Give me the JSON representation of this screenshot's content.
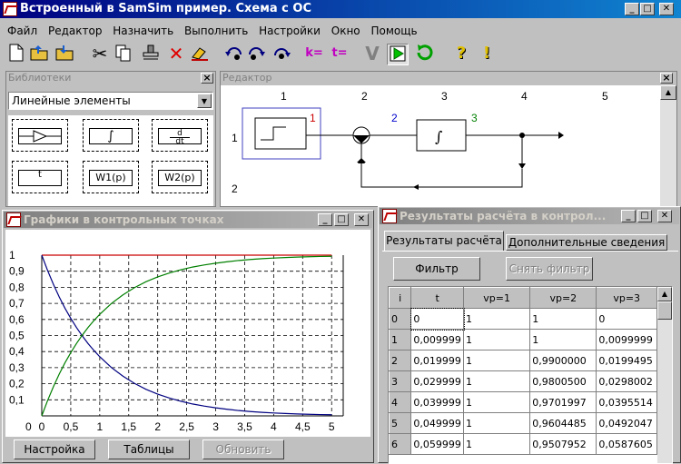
{
  "app": {
    "title": "Встроенный в SamSim пример. Схема с ОС"
  },
  "window_buttons": {
    "minimize": "_",
    "maximize": "□",
    "close": "✕"
  },
  "menu": [
    "Файл",
    "Редактор",
    "Назначить",
    "Выполнить",
    "Настройки",
    "Окно",
    "Помощь"
  ],
  "toolbar": {
    "icons": [
      "new-file-icon",
      "open-folder-icon",
      "save-folder-icon",
      "cut-icon",
      "copy-icon",
      "paste-stamp-icon",
      "delete-icon",
      "eraser-icon",
      "rotate-left-icon",
      "rotate-right-icon",
      "k-block-icon",
      "t-block-icon",
      "check-icon",
      "run-icon",
      "refresh-icon",
      "help-icon",
      "info-icon"
    ],
    "k_label": "k=",
    "t_label": "t=",
    "help_label": "?",
    "info_label": "!"
  },
  "library": {
    "title": "Библиотеки",
    "close": "×",
    "select_value": "Линейные элементы",
    "blocks": [
      "",
      "∫",
      "d/dt",
      "t",
      "W1(p)",
      "W2(p)"
    ],
    "d_num": "d",
    "d_den": "dt"
  },
  "editor": {
    "title": "Редактор",
    "close": "×",
    "col_labels": [
      "1",
      "2",
      "3",
      "4",
      "5"
    ],
    "row_labels": [
      "1",
      "2"
    ],
    "port_labels": [
      {
        "text": "1",
        "color": "#cc0000"
      },
      {
        "text": "2",
        "color": "#0000cc"
      },
      {
        "text": "3",
        "color": "#008000"
      }
    ]
  },
  "graphs": {
    "title": "Графики в контрольных точках",
    "buttons": {
      "settings": "Настройка",
      "tables": "Таблицы",
      "refresh": "Обновить"
    },
    "chart_data": {
      "type": "line",
      "x": [
        0,
        0.1,
        0.2,
        0.3,
        0.4,
        0.5,
        0.6,
        0.7,
        0.8,
        0.9,
        1.0,
        1.2,
        1.4,
        1.6,
        1.8,
        2.0,
        2.2,
        2.4,
        2.6,
        2.8,
        3.0,
        3.2,
        3.4,
        3.6,
        3.8,
        4.0,
        4.2,
        4.4,
        4.6,
        4.8,
        5.0
      ],
      "series": [
        {
          "color": "#cc0000",
          "values": [
            1,
            1,
            1,
            1,
            1,
            1,
            1,
            1,
            1,
            1,
            1,
            1,
            1,
            1,
            1,
            1,
            1,
            1,
            1,
            1,
            1,
            1,
            1,
            1,
            1,
            1,
            1,
            1,
            1,
            1,
            1
          ]
        },
        {
          "color": "#000080",
          "values": [
            1,
            0.905,
            0.819,
            0.741,
            0.67,
            0.607,
            0.549,
            0.497,
            0.449,
            0.407,
            0.368,
            0.301,
            0.247,
            0.202,
            0.165,
            0.135,
            0.111,
            0.091,
            0.074,
            0.061,
            0.05,
            0.041,
            0.033,
            0.027,
            0.022,
            0.018,
            0.015,
            0.012,
            0.01,
            0.008,
            0.007
          ]
        },
        {
          "color": "#008000",
          "values": [
            0,
            0.095,
            0.181,
            0.259,
            0.33,
            0.393,
            0.451,
            0.503,
            0.551,
            0.593,
            0.632,
            0.699,
            0.753,
            0.798,
            0.835,
            0.865,
            0.889,
            0.909,
            0.926,
            0.939,
            0.95,
            0.959,
            0.967,
            0.973,
            0.978,
            0.982,
            0.985,
            0.988,
            0.99,
            0.992,
            0.993
          ]
        }
      ],
      "xticks": [
        "0",
        "0,5",
        "1",
        "1,5",
        "2",
        "2,5",
        "3",
        "3,5",
        "4",
        "4,5",
        "5"
      ],
      "yticks": [
        "0,1",
        "0,2",
        "0,3",
        "0,4",
        "0,5",
        "0,6",
        "0,7",
        "0,8",
        "0,9",
        "1"
      ],
      "xlim": [
        0,
        5.2
      ],
      "ylim": [
        0,
        1
      ],
      "grid": true
    }
  },
  "results": {
    "title": "Результаты расчёта в контрол...",
    "tabs": [
      "Результаты расчёта",
      "Дополнительные сведения"
    ],
    "buttons": {
      "filter": "Фильтр",
      "clear_filter": "Снять фильтр"
    },
    "columns": [
      "i",
      "t",
      "vp=1",
      "vp=2",
      "vp=3"
    ],
    "rows": [
      [
        "0",
        "0",
        "1",
        "1",
        "0"
      ],
      [
        "1",
        "0,009999",
        "1",
        "1",
        "0,0099999"
      ],
      [
        "2",
        "0,019999",
        "1",
        "0,9900000",
        "0,0199495"
      ],
      [
        "3",
        "0,029999",
        "1",
        "0,9800500",
        "0,0298002"
      ],
      [
        "4",
        "0,039999",
        "1",
        "0,9701997",
        "0,0395514"
      ],
      [
        "5",
        "0,049999",
        "1",
        "0,9604485",
        "0,0492047"
      ],
      [
        "6",
        "0,059999",
        "1",
        "0,9507952",
        "0,0587605"
      ]
    ]
  }
}
